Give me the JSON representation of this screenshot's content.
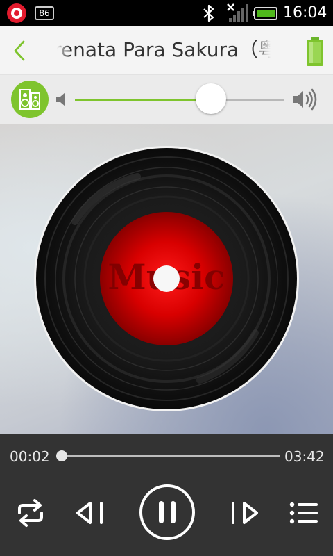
{
  "status_bar": {
    "notification_count": "86",
    "time": "16:04",
    "icons": [
      "beats-audio-icon",
      "notification-icon",
      "bluetooth-icon",
      "signal-icon",
      "battery-icon"
    ]
  },
  "header": {
    "title": "Serenata Para Sakura（粤语",
    "back_icon": "chevron-left-icon",
    "battery_icon": "battery-full-icon"
  },
  "volume": {
    "level": 0.65,
    "speaker_icon": "speaker-icon",
    "low_icon": "volume-low-icon",
    "high_icon": "volume-high-icon"
  },
  "album": {
    "label_text": "Music",
    "icon": "vinyl-record-icon"
  },
  "playback": {
    "elapsed": "00:02",
    "total": "03:42",
    "progress": 0.01,
    "state": "playing",
    "buttons": [
      "repeat-icon",
      "previous-icon",
      "pause-icon",
      "next-icon",
      "playlist-icon"
    ]
  },
  "colors": {
    "accent": "#7ec42d",
    "control_bg": "#333333",
    "label_red": "#c20000"
  }
}
